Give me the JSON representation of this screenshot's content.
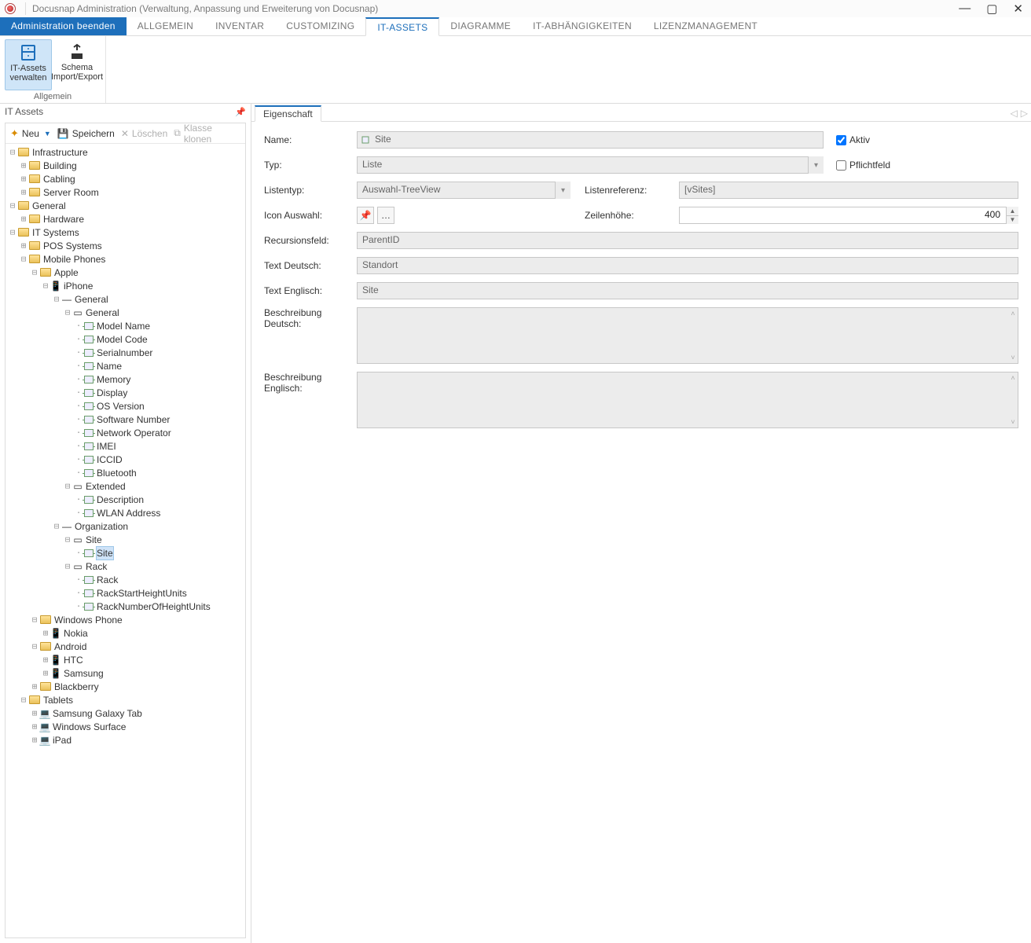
{
  "window": {
    "title": "Docusnap Administration (Verwaltung, Anpassung und Erweiterung von Docusnap)"
  },
  "menutabs": {
    "end": "Administration beenden",
    "items": [
      "ALLGEMEIN",
      "INVENTAR",
      "CUSTOMIZING",
      "IT-ASSETS",
      "DIAGRAMME",
      "IT-ABHÄNGIGKEITEN",
      "LIZENZMANAGEMENT"
    ],
    "active": "IT-ASSETS"
  },
  "ribbon": {
    "group_label": "Allgemein",
    "btn1_line1": "IT-Assets",
    "btn1_line2": "verwalten",
    "btn2_line1": "Schema",
    "btn2_line2": "Import/Export"
  },
  "leftpane": {
    "title": "IT Assets"
  },
  "toolbar": {
    "neu": "Neu",
    "speichern": "Speichern",
    "loeschen": "Löschen",
    "klonen": "Klasse klonen"
  },
  "tree": {
    "infrastructure": "Infrastructure",
    "building": "Building",
    "cabling": "Cabling",
    "serverroom": "Server Room",
    "general_top": "General",
    "hardware": "Hardware",
    "itsystems": "IT Systems",
    "pos": "POS Systems",
    "mobile": "Mobile Phones",
    "apple": "Apple",
    "iphone": "iPhone",
    "general_sec": "General",
    "general_grp": "General",
    "model_name": "Model Name",
    "model_code": "Model Code",
    "serial": "Serialnumber",
    "name": "Name",
    "memory": "Memory",
    "display": "Display",
    "osver": "OS Version",
    "softno": "Software Number",
    "netop": "Network Operator",
    "imei": "IMEI",
    "iccid": "ICCID",
    "bluetooth": "Bluetooth",
    "extended": "Extended",
    "description": "Description",
    "wlan": "WLAN Address",
    "organization": "Organization",
    "site_grp": "Site",
    "site_field": "Site",
    "rack_grp": "Rack",
    "rack_field": "Rack",
    "rackstart": "RackStartHeightUnits",
    "racknum": "RackNumberOfHeightUnits",
    "winphone": "Windows Phone",
    "nokia": "Nokia",
    "android": "Android",
    "htc": "HTC",
    "samsung": "Samsung",
    "blackberry": "Blackberry",
    "tablets": "Tablets",
    "galaxy": "Samsung Galaxy Tab",
    "surface": "Windows Surface",
    "ipad": "iPad"
  },
  "proptab": "Eigenschaft",
  "form": {
    "name_lbl": "Name:",
    "name_val": "Site",
    "aktiv_lbl": "Aktiv",
    "typ_lbl": "Typ:",
    "typ_val": "Liste",
    "pflicht_lbl": "Pflichtfeld",
    "listentyp_lbl": "Listentyp:",
    "listentyp_val": "Auswahl-TreeView",
    "listenref_lbl": "Listenreferenz:",
    "listenref_val": "[vSites]",
    "iconauswahl_lbl": "Icon Auswahl:",
    "zeilenhoehe_lbl": "Zeilenhöhe:",
    "zeilenhoehe_val": "400",
    "recursion_lbl": "Recursionsfeld:",
    "recursion_val": "ParentID",
    "textde_lbl": "Text Deutsch:",
    "textde_val": "Standort",
    "texten_lbl": "Text Englisch:",
    "texten_val": "Site",
    "beschde_lbl": "Beschreibung Deutsch:",
    "beschen_lbl": "Beschreibung Englisch:"
  }
}
